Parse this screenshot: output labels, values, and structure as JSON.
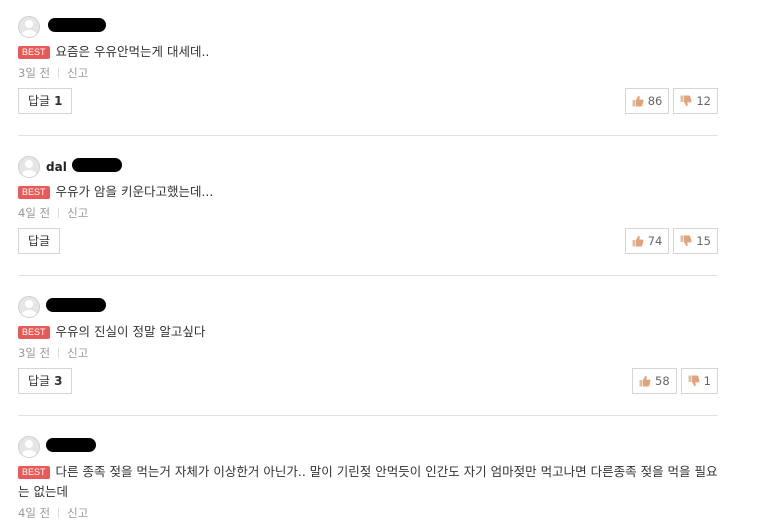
{
  "comments": [
    {
      "username": "",
      "best_label": "BEST",
      "text": "요즘은 우유안먹는게 대세데..",
      "time": "3일 전",
      "report": "신고",
      "reply_label": "답글",
      "reply_count": "1",
      "likes": "86",
      "dislikes": "12"
    },
    {
      "username": "dal",
      "best_label": "BEST",
      "text": "우유가 암을 키운다고했는데...",
      "time": "4일 전",
      "report": "신고",
      "reply_label": "답글",
      "reply_count": "",
      "likes": "74",
      "dislikes": "15"
    },
    {
      "username": "",
      "best_label": "BEST",
      "text": "우유의 진실이 정말 알고싶다",
      "time": "3일 전",
      "report": "신고",
      "reply_label": "답글",
      "reply_count": "3",
      "likes": "58",
      "dislikes": "1"
    },
    {
      "username": "",
      "best_label": "BEST",
      "text": "다른 종족 젖을 먹는거 자체가 이상한거 아닌가.. 말이 기린젖 안먹듯이 인간도 자기 엄마젖만 먹고나면 다른종족 젖을 먹을 필요는 없는데",
      "time": "4일 전",
      "report": "신고"
    }
  ],
  "icons": {
    "like": "thumbs-up-icon",
    "dislike": "thumbs-down-icon",
    "avatar": "default-avatar-icon"
  },
  "colors": {
    "best_badge": "#e85a57",
    "like_thumb": "#e3a27a",
    "dislike_thumb": "#e3a27a"
  }
}
